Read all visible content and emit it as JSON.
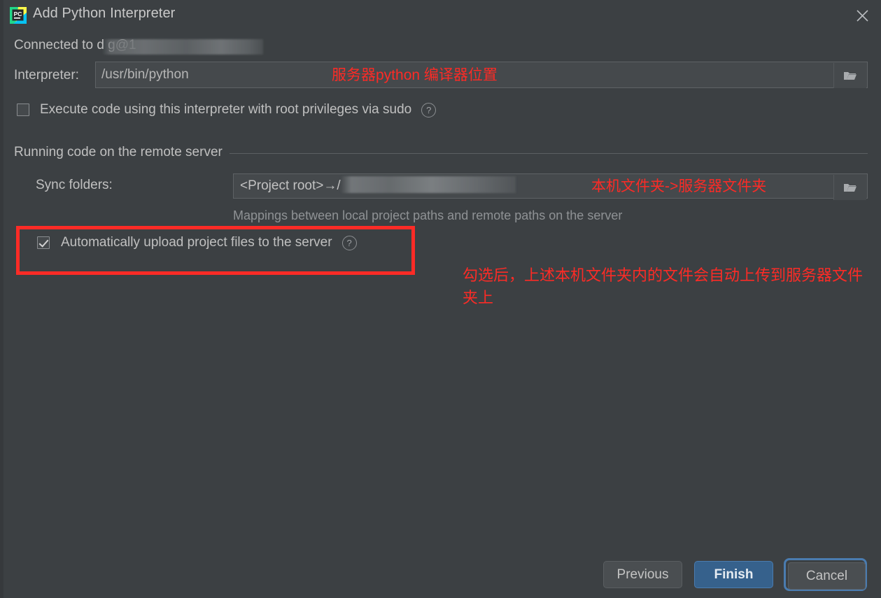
{
  "window": {
    "title": "Add Python Interpreter",
    "app_icon": "pycharm-logo-icon",
    "close_icon": "close-icon",
    "background_color": "#3c4043"
  },
  "connection": {
    "label": "Connected to",
    "host": "d       g@1                   ",
    "redacted": true
  },
  "interpreter": {
    "label": "Interpreter:",
    "value": "/usr/bin/python",
    "browse_icon": "folder-icon"
  },
  "sudo": {
    "label": "Execute code using this interpreter with root privileges via sudo",
    "checked": false,
    "help_icon": "question-mark-icon",
    "help_glyph": "?"
  },
  "remote_group": {
    "title": "Running code on the remote server"
  },
  "sync": {
    "label": "Sync folders:",
    "value": "<Project root>→/",
    "redacted": true,
    "hint": "Mappings between local project paths and remote paths on the server",
    "browse_icon": "folder-icon"
  },
  "auto_upload": {
    "label": "Automatically upload project files to the server",
    "checked": true,
    "help_icon": "question-mark-icon",
    "help_glyph": "?"
  },
  "annotations": {
    "color": "#fc2b26",
    "interpreter_note": "服务器python 编译器位置",
    "sync_note": "本机文件夹->服务器文件夹",
    "upload_note": "勾选后，上述本机文件夹内的文件会自动上传到服务器文件夹上"
  },
  "footer": {
    "previous_label": "Previous",
    "finish_label": "Finish",
    "cancel_label": "Cancel",
    "finish_color": "#36618c",
    "focus_ring_color": "#4a7cb0"
  }
}
